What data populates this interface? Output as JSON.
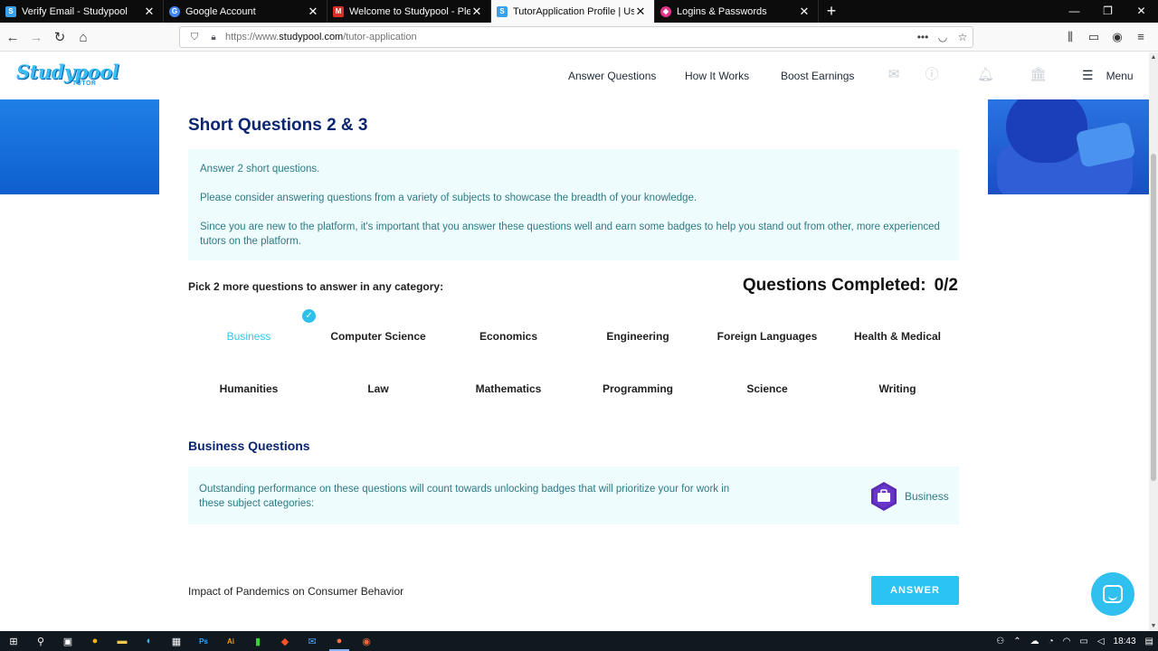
{
  "browser": {
    "tabs": [
      {
        "title": "Verify Email - Studypool",
        "icon": "studypool-favicon",
        "color": "#3aa0ea",
        "active": false
      },
      {
        "title": "Google Account",
        "icon": "google-favicon",
        "color": "#4285f4",
        "active": false
      },
      {
        "title": "Welcome to Studypool - Please",
        "icon": "gmail-favicon",
        "color": "#d93025",
        "active": false
      },
      {
        "title": "TutorApplication Profile | User",
        "icon": "studypool-favicon",
        "color": "#3aa0ea",
        "active": true
      },
      {
        "title": "Logins & Passwords",
        "icon": "lockwise-favicon",
        "color": "#e9328a",
        "active": false
      }
    ],
    "url_prefix": "https://www.",
    "url_domain": "studypool.com",
    "url_path": "/tutor-application"
  },
  "site": {
    "logo_text": "Studypool",
    "logo_sub": "TUTOR",
    "nav": [
      "Answer Questions",
      "How It Works",
      "Boost Earnings"
    ],
    "header_icons": [
      "mail-icon",
      "alert-icon",
      "bell-icon",
      "bank-icon"
    ],
    "menu_label": "Menu"
  },
  "page": {
    "title": "Short Questions 2 & 3",
    "intro": [
      "Answer 2 short questions.",
      "Please consider answering questions from a variety of subjects to showcase the breadth of your knowledge.",
      "Since you are new to the platform, it's important that you answer these questions well and earn some badges to help you stand out from other, more experienced tutors on the platform."
    ],
    "pick_label": "Pick 2 more questions to answer in any category:",
    "completed_label": "Questions Completed:",
    "completed_value": "0/2",
    "categories": [
      [
        "Business",
        "Computer Science",
        "Economics",
        "Engineering",
        "Foreign Languages",
        "Health & Medical"
      ],
      [
        "Humanities",
        "Law",
        "Mathematics",
        "Programming",
        "Science",
        "Writing"
      ]
    ],
    "selected_category": "Business",
    "section_title": "Business Questions",
    "badge_text": "Outstanding performance on these questions will count towards unlocking badges that will prioritize your for work in these subject categories:",
    "badge_label": "Business",
    "question": "Impact of Pandemics on Consumer Behavior",
    "answer_button": "ANSWER"
  },
  "taskbar": {
    "time": "18:43"
  },
  "colors": {
    "accent": "#2ac3f2",
    "heading": "#0b2570",
    "info_bg": "#effcfd",
    "info_text": "#2d7a85"
  }
}
